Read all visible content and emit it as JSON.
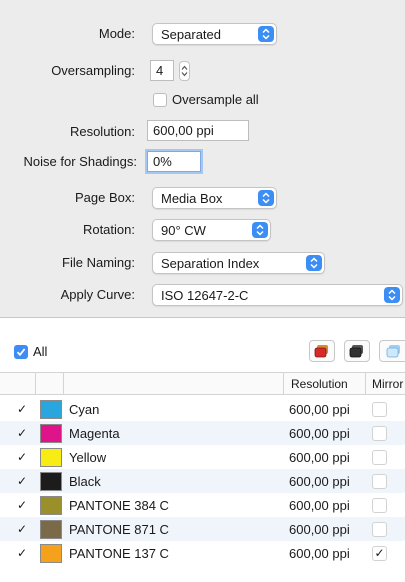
{
  "settings": {
    "mode": {
      "label": "Mode:",
      "value": "Separated"
    },
    "oversampling": {
      "label": "Oversampling:",
      "value": "4"
    },
    "oversample_all": {
      "label": "Oversample all",
      "checked": false
    },
    "resolution": {
      "label": "Resolution:",
      "value": "600,00 ppi"
    },
    "noise": {
      "label": "Noise for Shadings:",
      "value": "0%"
    },
    "page_box": {
      "label": "Page Box:",
      "value": "Media Box"
    },
    "rotation": {
      "label": "Rotation:",
      "value": "90° CW"
    },
    "file_naming": {
      "label": "File Naming:",
      "value": "Separation Index"
    },
    "apply_curve": {
      "label": "Apply Curve:",
      "value": "ISO 12647-2-C"
    }
  },
  "list": {
    "all_label": "All",
    "all_checked": true,
    "headers": {
      "resolution": "Resolution",
      "mirror": "Mirror"
    },
    "rows": [
      {
        "checked": "✓",
        "color": "#2aa6df",
        "name": "Cyan",
        "resolution": "600,00 ppi",
        "mirror": ""
      },
      {
        "checked": "✓",
        "color": "#e0148a",
        "name": "Magenta",
        "resolution": "600,00 ppi",
        "mirror": ""
      },
      {
        "checked": "✓",
        "color": "#f7ec13",
        "name": "Yellow",
        "resolution": "600,00 ppi",
        "mirror": ""
      },
      {
        "checked": "✓",
        "color": "#1c1c1c",
        "name": "Black",
        "resolution": "600,00 ppi",
        "mirror": ""
      },
      {
        "checked": "✓",
        "color": "#9a8f2a",
        "name": "PANTONE 384 C",
        "resolution": "600,00 ppi",
        "mirror": ""
      },
      {
        "checked": "✓",
        "color": "#7a6a47",
        "name": "PANTONE 871 C",
        "resolution": "600,00 ppi",
        "mirror": ""
      },
      {
        "checked": "✓",
        "color": "#f4a11b",
        "name": "PANTONE 137 C",
        "resolution": "600,00 ppi",
        "mirror": "✓"
      }
    ]
  },
  "colors": {
    "accent": "#3d8ef4",
    "alt_row": "#f0f5fc"
  }
}
